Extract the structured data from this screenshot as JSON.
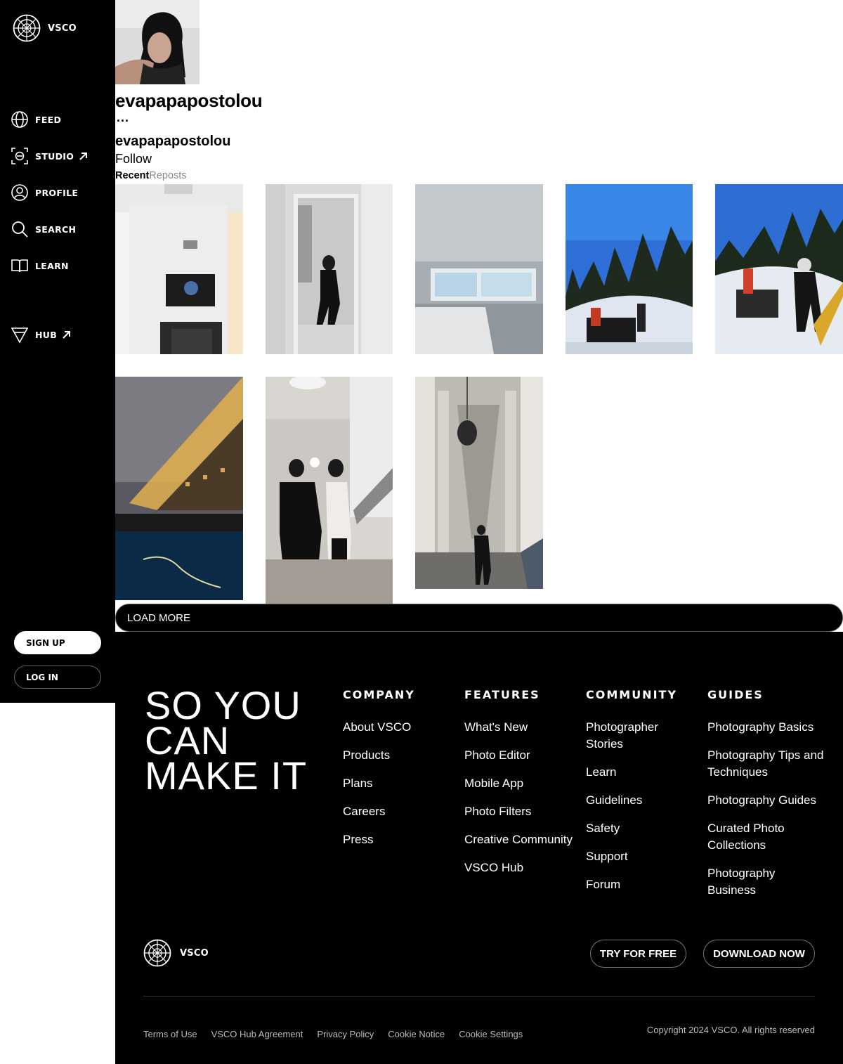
{
  "brand": {
    "name": "VSCO",
    "logo_icon": "vsco-logo-icon"
  },
  "sidebar": {
    "nav": [
      {
        "label": "FEED",
        "icon": "globe-icon"
      },
      {
        "label": "STUDIO",
        "icon": "studio-icon",
        "external": true
      },
      {
        "label": "PROFILE",
        "icon": "user-icon"
      },
      {
        "label": "SEARCH",
        "icon": "search-icon"
      },
      {
        "label": "LEARN",
        "icon": "book-icon"
      },
      {
        "label": "HUB",
        "icon": "hub-triangle-icon",
        "external": true
      }
    ],
    "signup_label": "SIGN UP",
    "login_label": "LOG IN"
  },
  "profile": {
    "username": "evapapapostolou",
    "display_name": "evapapapostolou",
    "more": "...",
    "follow_label": "Follow",
    "tabs": [
      "Recent",
      "Reposts"
    ],
    "active_tab": "Recent"
  },
  "gallery": {
    "count": 8,
    "load_more_label": "LOAD MORE"
  },
  "footer": {
    "headline": "SO YOU CAN MAKE IT",
    "columns": [
      {
        "title": "COMPANY",
        "links": [
          "About VSCO",
          "Products",
          "Plans",
          "Careers",
          "Press"
        ]
      },
      {
        "title": "FEATURES",
        "links": [
          "What's New",
          "Photo Editor",
          "Mobile App",
          "Photo Filters",
          "Creative Community",
          "VSCO Hub"
        ]
      },
      {
        "title": "COMMUNITY",
        "links": [
          "Photographer Stories",
          "Learn",
          "Guidelines",
          "Safety",
          "Support",
          "Forum"
        ]
      },
      {
        "title": "GUIDES",
        "links": [
          "Photography Basics",
          "Photography Tips and Techniques",
          "Photography Guides",
          "Curated Photo Collections",
          "Photography Business"
        ]
      }
    ],
    "try_free_label": "TRY FOR FREE",
    "download_label": "DOWNLOAD NOW",
    "legal_links": [
      "Terms of Use",
      "VSCO Hub Agreement",
      "Privacy Policy",
      "Cookie Notice",
      "Cookie Settings"
    ],
    "copyright": "Copyright 2024 VSCO. All rights reserved"
  }
}
